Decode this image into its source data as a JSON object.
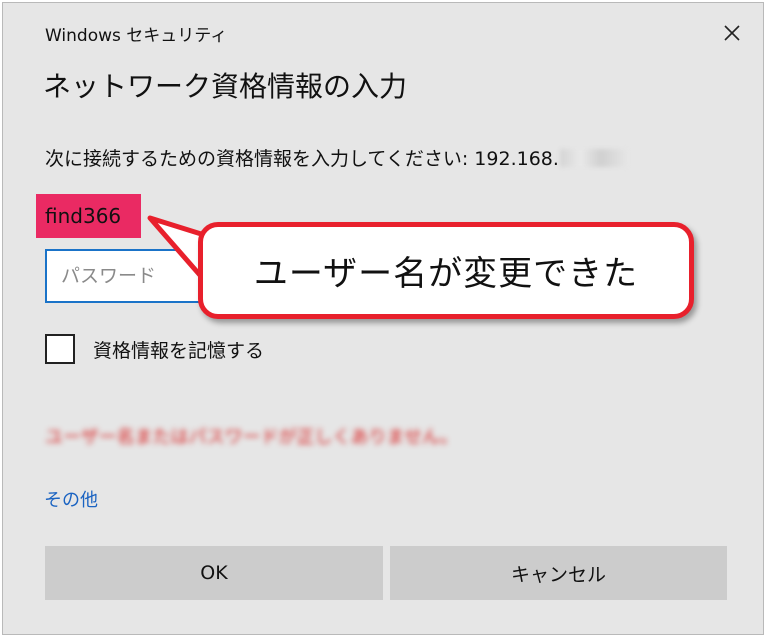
{
  "window": {
    "title": "Windows セキュリティ",
    "close_icon": "close-icon"
  },
  "dialog": {
    "heading": "ネットワーク資格情報の入力",
    "prompt_prefix": "次に接続するための資格情報を入力してください: 192.168.",
    "username": "find366",
    "password_placeholder": "パスワード",
    "remember_label": "資格情報を記憶する",
    "error_message": "ユーザー名またはパスワードが正しくありません。",
    "more_link": "その他",
    "ok_label": "OK",
    "cancel_label": "キャンセル"
  },
  "annotation": {
    "callout_text": "ユーザー名が変更できた"
  },
  "colors": {
    "tag_background": "#ea2a63",
    "input_border": "#1a73c8",
    "callout_border": "#e8202c",
    "link": "#1a63c2"
  }
}
